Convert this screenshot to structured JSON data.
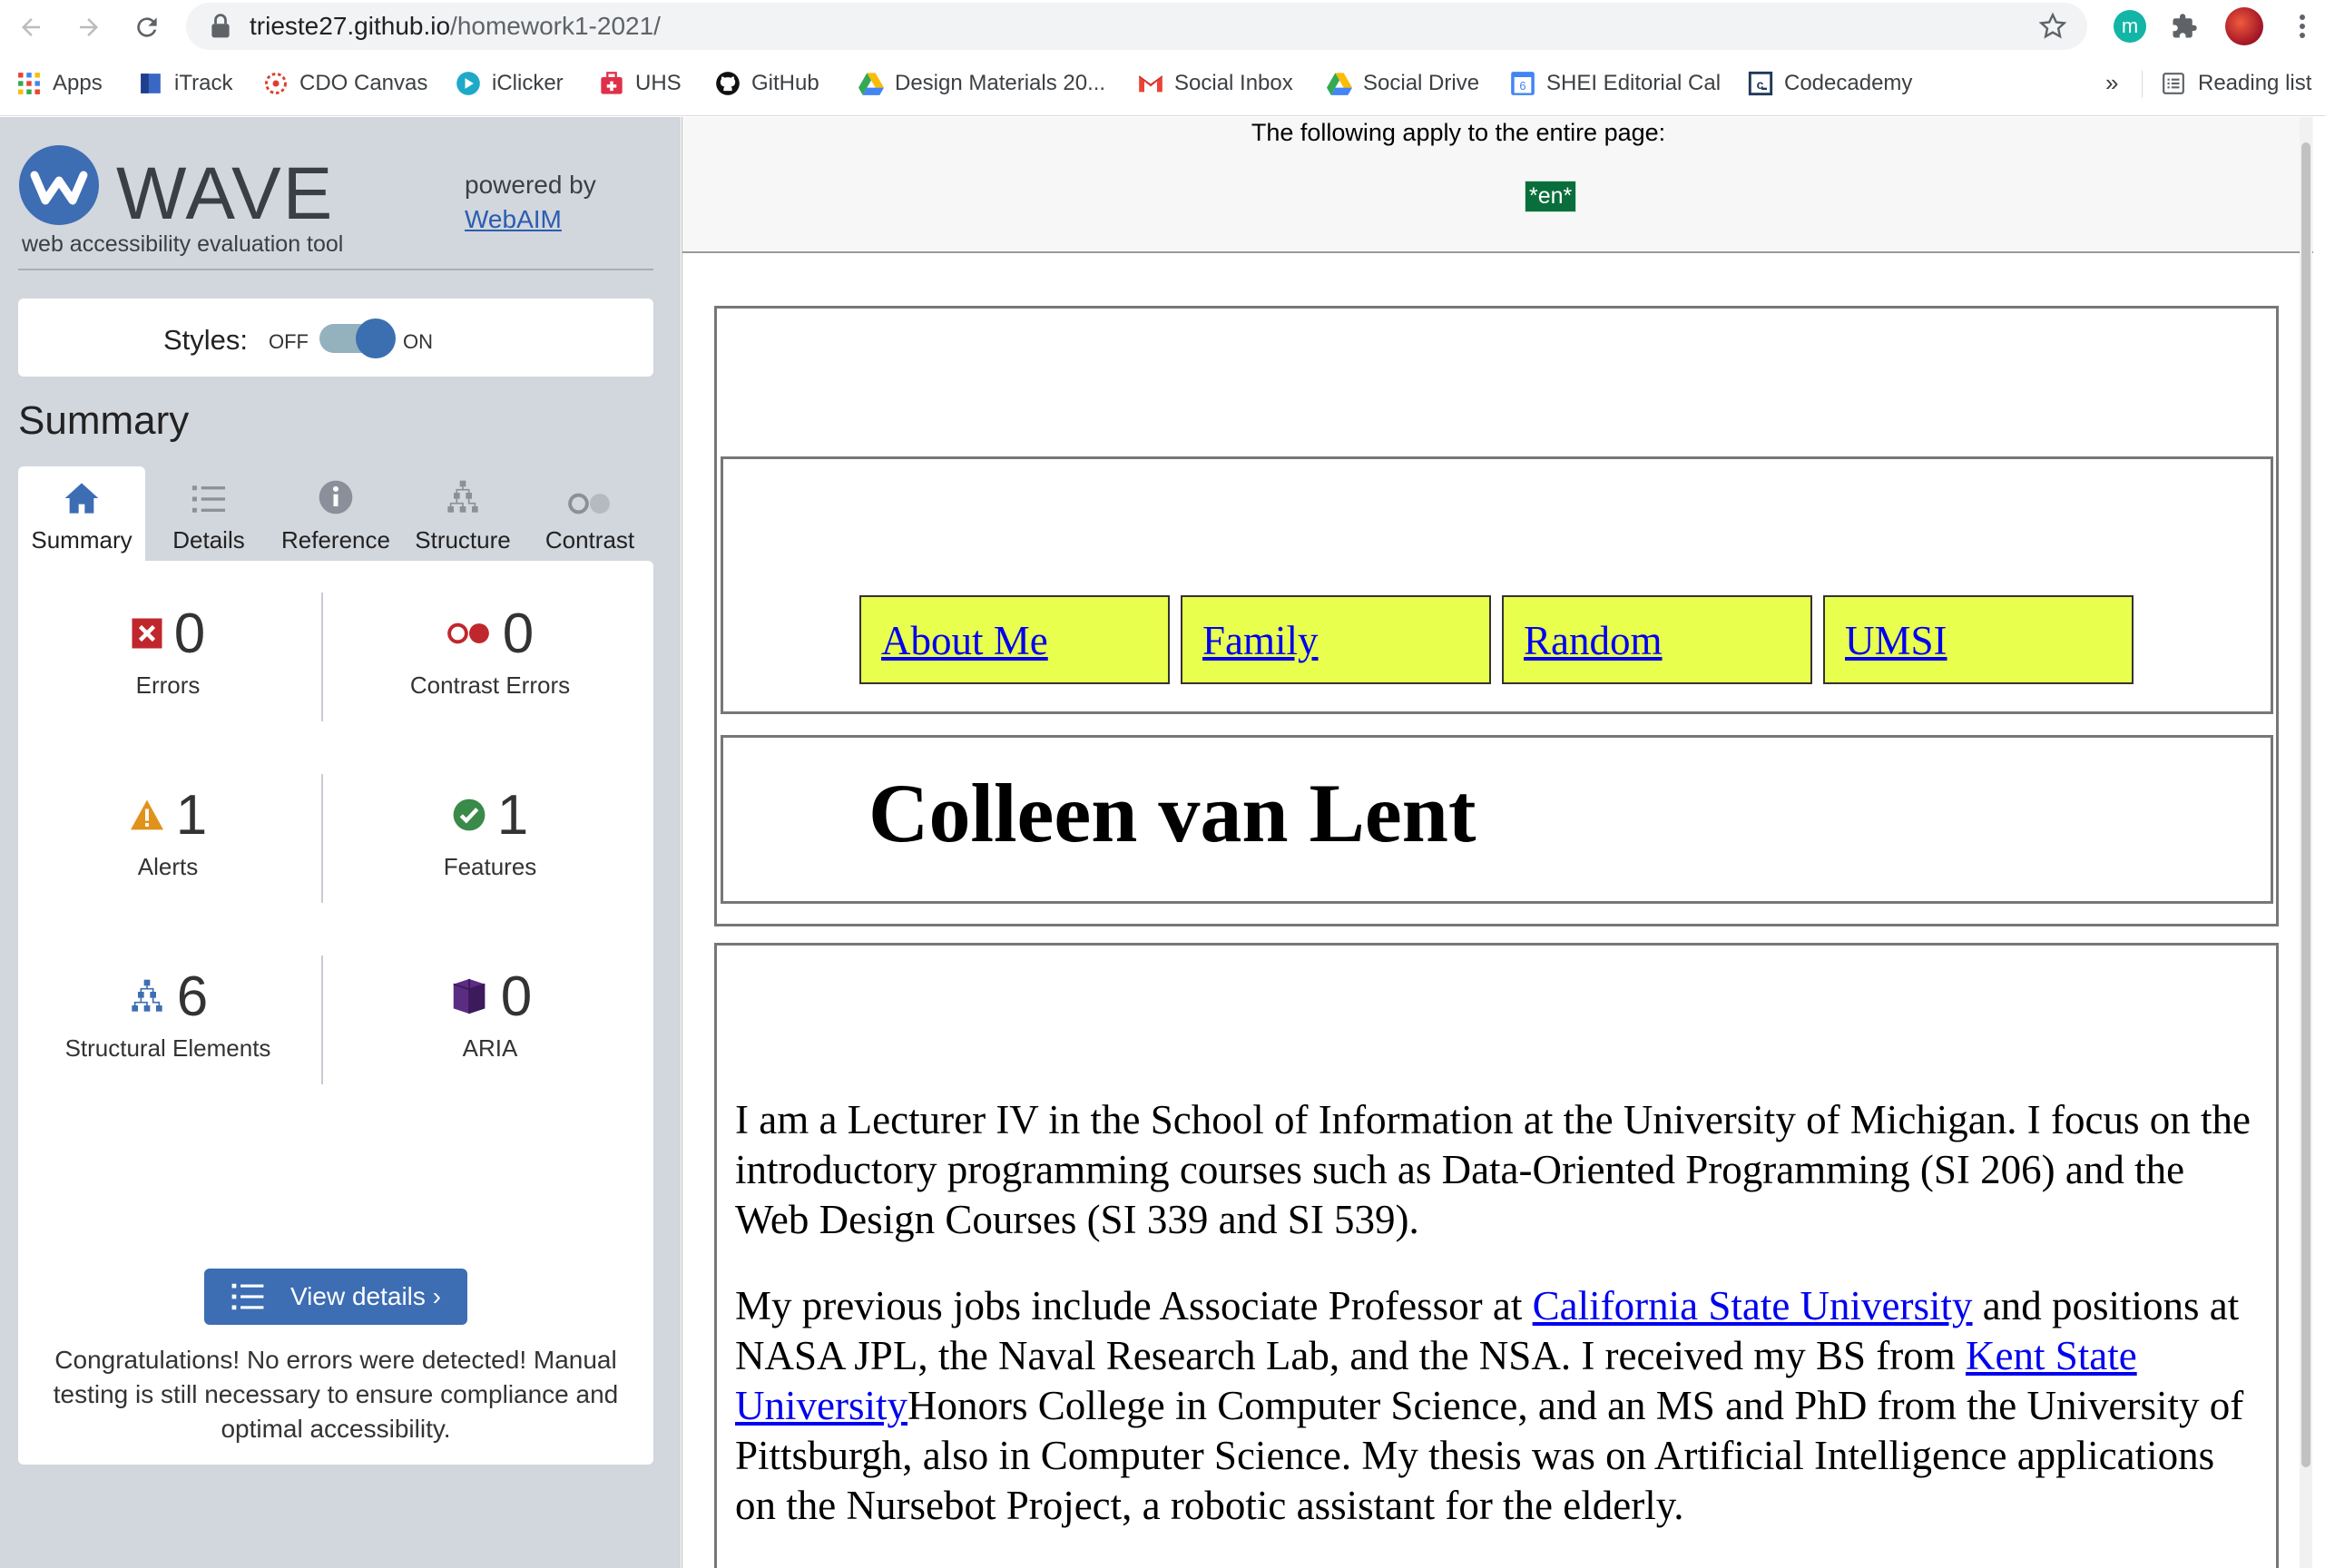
{
  "browser": {
    "url_host": "trieste27.github.io",
    "url_path": "/homework1-2021/",
    "extension_m_label": "m",
    "bookmarks": [
      {
        "label": "Apps",
        "icon": "apps-grid-icon"
      },
      {
        "label": "iTrack",
        "icon": "itrack-icon"
      },
      {
        "label": "CDO Canvas",
        "icon": "canvas-icon"
      },
      {
        "label": "iClicker",
        "icon": "iclicker-icon"
      },
      {
        "label": "UHS",
        "icon": "uhs-icon"
      },
      {
        "label": "GitHub",
        "icon": "github-icon"
      },
      {
        "label": "Design Materials 20...",
        "icon": "google-drive-icon"
      },
      {
        "label": "Social Inbox",
        "icon": "gmail-icon"
      },
      {
        "label": "Social Drive",
        "icon": "google-drive-icon"
      },
      {
        "label": "SHEI Editorial Cal",
        "icon": "google-calendar-icon"
      },
      {
        "label": "Codecademy",
        "icon": "codecademy-icon"
      }
    ],
    "bookmarks_overflow": "»",
    "reading_list": "Reading list"
  },
  "wave": {
    "title": "WAVE",
    "subtitle": "web accessibility evaluation tool",
    "powered_by": "powered by",
    "powered_link": "WebAIM",
    "styles_label": "Styles:",
    "styles_off": "OFF",
    "styles_on": "ON",
    "styles_state": "on",
    "summary_heading": "Summary",
    "tabs": [
      {
        "label": "Summary",
        "icon": "home-icon",
        "active": true
      },
      {
        "label": "Details",
        "icon": "list-icon",
        "active": false
      },
      {
        "label": "Reference",
        "icon": "info-icon",
        "active": false
      },
      {
        "label": "Structure",
        "icon": "structure-icon",
        "active": false
      },
      {
        "label": "Contrast",
        "icon": "contrast-icon",
        "active": false
      }
    ],
    "stats": {
      "errors": {
        "count": "0",
        "label": "Errors"
      },
      "contrast_errors": {
        "count": "0",
        "label": "Contrast Errors"
      },
      "alerts": {
        "count": "1",
        "label": "Alerts"
      },
      "features": {
        "count": "1",
        "label": "Features"
      },
      "structural": {
        "count": "6",
        "label": "Structural Elements"
      },
      "aria": {
        "count": "0",
        "label": "ARIA"
      }
    },
    "view_details": "View details ›",
    "congrats": "Congratulations! No errors were detected! Manual testing is still necessary to ensure compliance and optimal accessibility.",
    "colors": {
      "sidebar_bg": "#d2d6dd",
      "accent": "#3d6db3",
      "error": "#c0272d",
      "alert": "#e0921a",
      "feature": "#3a8a4a",
      "aria": "#5b2d82"
    }
  },
  "page": {
    "entire_page_note": "The following apply to the entire page:",
    "lang_badge": "*en*",
    "nav": [
      "About Me",
      "Family",
      "Random",
      "UMSI"
    ],
    "name": "Colleen van Lent",
    "para1": "I am a Lecturer IV in the School of Information at the University of Michigan. I focus on the introductory programming courses such as Data-Oriented Programming (SI 206) and the Web Design Courses (SI 339 and SI 539).",
    "para2_a": "My previous jobs include Associate Professor at ",
    "para2_link1": "California State University",
    "para2_b": " and positions at NASA JPL, the Naval Research Lab, and the NSA. I received my BS from ",
    "para2_link2": "Kent State University",
    "para2_c": "Honors College in Computer Science, and an MS and PhD from the University of Pittsburgh, also in Computer Science. My thesis was on Artificial Intelligence applications on the Nursebot Project, a robotic assistant for the elderly.",
    "colors": {
      "nav_bg": "#e9ff4d",
      "link": "#0000ee",
      "badge_bg": "#0a6e3c"
    }
  }
}
